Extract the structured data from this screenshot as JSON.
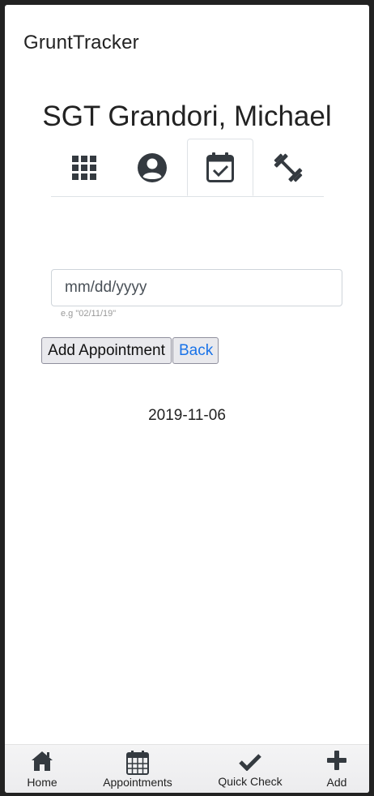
{
  "app": {
    "title": "GruntTracker"
  },
  "soldier": {
    "name": "SGT Grandori, Michael"
  },
  "tabs": [
    {
      "icon": "grid-icon",
      "active": false
    },
    {
      "icon": "user-circle-icon",
      "active": false
    },
    {
      "icon": "calendar-check-icon",
      "active": true
    },
    {
      "icon": "dumbbell-icon",
      "active": false
    }
  ],
  "form": {
    "date_placeholder": "mm/dd/yyyy",
    "date_value": "",
    "hint": "e.g \"02/11/19\"",
    "add_label": "Add Appointment",
    "back_label": "Back"
  },
  "appointments": [
    {
      "date": "2019-11-06"
    }
  ],
  "bottom_nav": [
    {
      "label": "Home",
      "icon": "home-icon"
    },
    {
      "label": "Appointments",
      "icon": "calendar-icon"
    },
    {
      "label": "Quick Check",
      "icon": "check-icon"
    },
    {
      "label": "Add",
      "icon": "plus-icon"
    }
  ],
  "colors": {
    "icon": "#343a40",
    "link": "#1a73e8"
  }
}
